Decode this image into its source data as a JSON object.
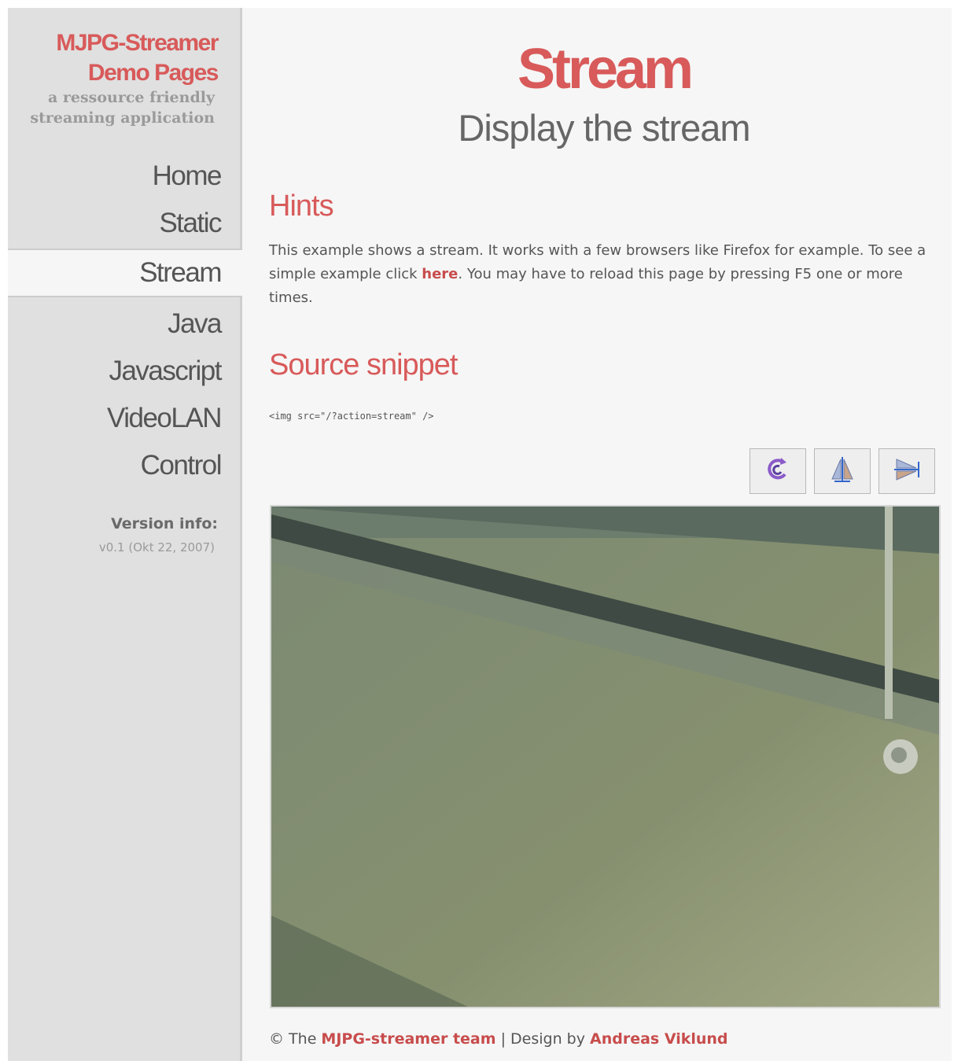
{
  "sidebar": {
    "title_line1": "MJPG-Streamer",
    "title_line2": "Demo Pages",
    "subtitle_line1": "a ressource friendly",
    "subtitle_line2": "streaming application",
    "nav": [
      "Home",
      "Static",
      "Stream",
      "Java",
      "Javascript",
      "VideoLAN",
      "Control"
    ],
    "active_nav": "Stream",
    "version_title": "Version info:",
    "version_value": "v0.1 (Okt 22, 2007)"
  },
  "main": {
    "title": "Stream",
    "subtitle": "Display the stream",
    "hints_heading": "Hints",
    "hints_text_1": "This example shows a stream. It works with a few browsers like Firefox for example. To see a simple example click ",
    "hints_link": "here",
    "hints_text_2": ". You may have to reload this page by pressing F5 one or more times.",
    "source_heading": "Source snippet",
    "source_code": "<img src=\"/?action=stream\" />",
    "toolbar": [
      {
        "name": "rotate-icon"
      },
      {
        "name": "flip-vertical-icon"
      },
      {
        "name": "flip-horizontal-icon"
      }
    ],
    "footer_prefix": "© The ",
    "footer_link1": "MJPG-streamer team",
    "footer_mid": " | Design by ",
    "footer_link2": "Andreas Viklund"
  },
  "colors": {
    "accent": "#d85a5a",
    "sidebar_bg": "#e0e0e0",
    "main_bg": "#f6f6f6",
    "text": "#555555"
  }
}
